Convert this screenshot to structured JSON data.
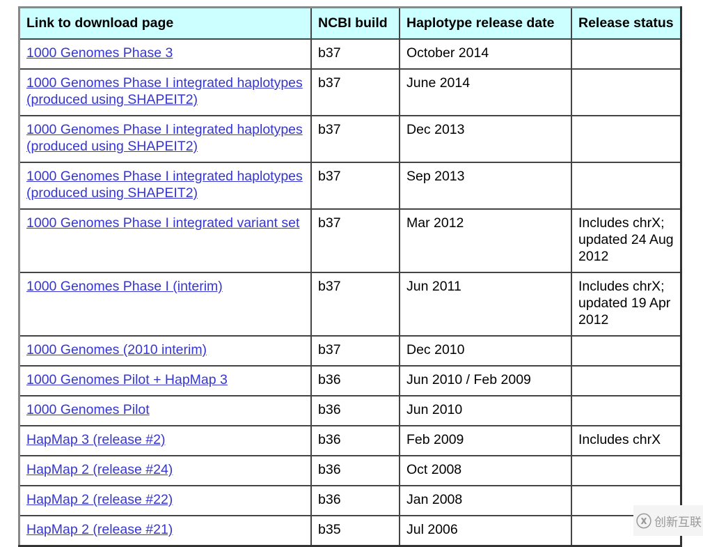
{
  "headers": [
    "Link to download page",
    "NCBI build",
    "Haplotype release date",
    "Release status"
  ],
  "rows": [
    {
      "link": "1000 Genomes Phase 3",
      "build": "b37",
      "date": "October 2014",
      "status": ""
    },
    {
      "link": "1000 Genomes Phase I integrated haplotypes (produced using SHAPEIT2)",
      "build": "b37",
      "date": "June 2014",
      "status": ""
    },
    {
      "link": "1000 Genomes Phase I integrated haplotypes (produced using SHAPEIT2)",
      "build": "b37",
      "date": "Dec 2013",
      "status": ""
    },
    {
      "link": "1000 Genomes Phase I integrated haplotypes (produced using SHAPEIT2)",
      "build": "b37",
      "date": "Sep 2013",
      "status": ""
    },
    {
      "link": "1000 Genomes Phase I integrated variant set",
      "build": "b37",
      "date": "Mar 2012",
      "status": "Includes chrX; updated 24 Aug 2012"
    },
    {
      "link": "1000 Genomes Phase I (interim)",
      "build": "b37",
      "date": "Jun 2011",
      "status": "Includes chrX; updated 19 Apr 2012"
    },
    {
      "link": "1000 Genomes (2010 interim)",
      "build": "b37",
      "date": "Dec 2010",
      "status": ""
    },
    {
      "link": "1000 Genomes Pilot + HapMap 3",
      "build": "b36",
      "date": "Jun 2010 / Feb 2009",
      "status": ""
    },
    {
      "link": "1000 Genomes Pilot",
      "build": "b36",
      "date": "Jun 2010",
      "status": ""
    },
    {
      "link": "HapMap 3 (release #2)",
      "build": "b36",
      "date": "Feb 2009",
      "status": "Includes chrX"
    },
    {
      "link": "HapMap 2 (release #24)",
      "build": "b36",
      "date": "Oct 2008",
      "status": ""
    },
    {
      "link": "HapMap 2 (release #22)",
      "build": "b36",
      "date": "Jan 2008",
      "status": ""
    },
    {
      "link": "HapMap 2 (release #21)",
      "build": "b35",
      "date": "Jul 2006",
      "status": ""
    }
  ],
  "watermark": {
    "text": "创新互联",
    "icon": "cx-logo-icon"
  }
}
